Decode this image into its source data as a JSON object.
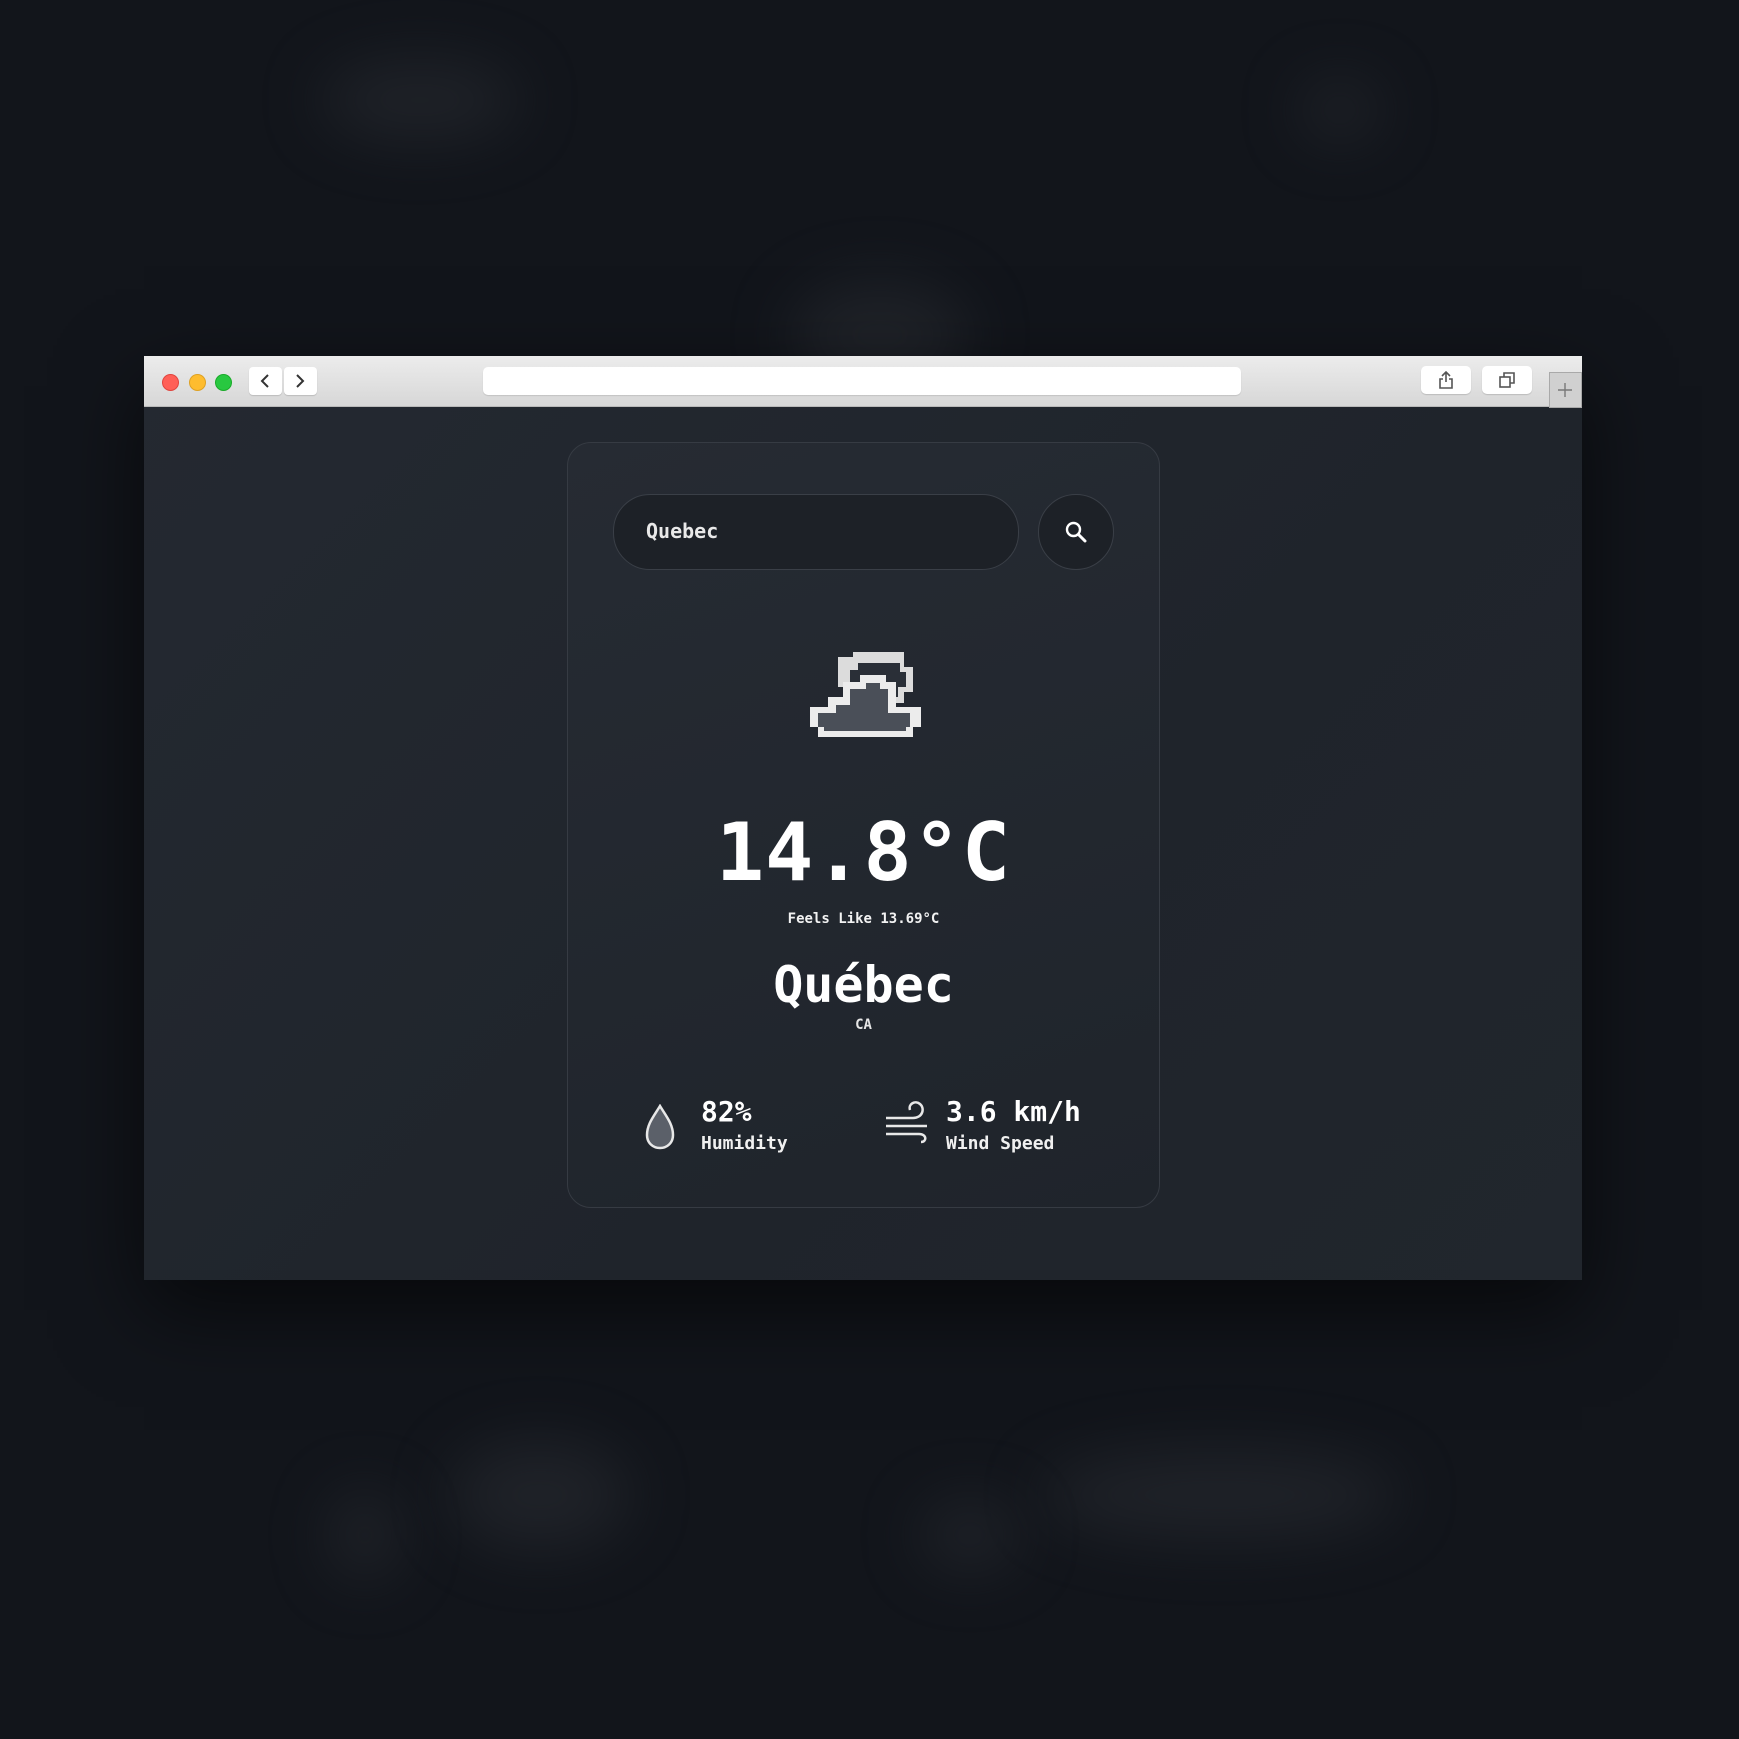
{
  "search": {
    "value": "Quebec"
  },
  "weather": {
    "icon": "cloud-with-sun-icon",
    "temperature": "14.8°C",
    "feels_like": "Feels Like 13.69°C",
    "city": "Québec",
    "country": "CA"
  },
  "stats": {
    "humidity": {
      "value": "82%",
      "label": "Humidity",
      "icon": "water-drop-icon"
    },
    "wind": {
      "value": "3.6 km/h",
      "label": "Wind Speed",
      "icon": "wind-icon"
    }
  },
  "colors": {
    "background": "#12151b",
    "card": "#262b33",
    "text": "#ffffff"
  }
}
